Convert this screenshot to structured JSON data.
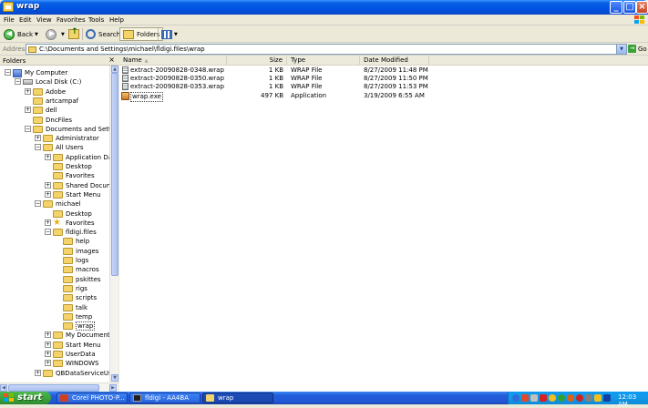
{
  "window": {
    "title": "wrap"
  },
  "menu": [
    "File",
    "Edit",
    "View",
    "Favorites",
    "Tools",
    "Help"
  ],
  "toolbar": {
    "back_label": "Back",
    "search_label": "Search",
    "folders_label": "Folders"
  },
  "address": {
    "label": "Address",
    "value": "C:\\Documents and Settings\\michael\\fldigi.files\\wrap",
    "go_label": "Go"
  },
  "folders_pane": {
    "title": "Folders",
    "close_glyph": "×"
  },
  "tree": [
    {
      "label": "My Computer",
      "level": 0,
      "icon": "computer-icon",
      "expander": "minus"
    },
    {
      "label": "Local Disk (C:)",
      "level": 1,
      "icon": "disk-icon",
      "expander": "minus"
    },
    {
      "label": "Adobe",
      "level": 2,
      "icon": "folder-icon",
      "expander": "plus"
    },
    {
      "label": "artcampaf",
      "level": 2,
      "icon": "folder-icon",
      "expander": ""
    },
    {
      "label": "dell",
      "level": 2,
      "icon": "folder-icon",
      "expander": "plus"
    },
    {
      "label": "DncFiles",
      "level": 2,
      "icon": "folder-icon",
      "expander": ""
    },
    {
      "label": "Documents and Setting",
      "level": 2,
      "icon": "folder-icon",
      "expander": "minus"
    },
    {
      "label": "Administrator",
      "level": 3,
      "icon": "folder-icon",
      "expander": "plus"
    },
    {
      "label": "All Users",
      "level": 3,
      "icon": "folder-icon",
      "expander": "minus"
    },
    {
      "label": "Application Data",
      "level": 4,
      "icon": "folder-icon",
      "expander": "plus"
    },
    {
      "label": "Desktop",
      "level": 4,
      "icon": "folder-icon",
      "expander": ""
    },
    {
      "label": "Favorites",
      "level": 4,
      "icon": "folder-icon",
      "expander": ""
    },
    {
      "label": "Shared Docume",
      "level": 4,
      "icon": "folder-icon",
      "expander": "plus"
    },
    {
      "label": "Start Menu",
      "level": 4,
      "icon": "folder-icon",
      "expander": "plus"
    },
    {
      "label": "michael",
      "level": 3,
      "icon": "folder-icon",
      "expander": "minus"
    },
    {
      "label": "Desktop",
      "level": 4,
      "icon": "folder-icon",
      "expander": ""
    },
    {
      "label": "Favorites",
      "level": 4,
      "icon": "star-icon",
      "expander": "plus"
    },
    {
      "label": "fldigi.files",
      "level": 4,
      "icon": "folder-icon",
      "expander": "minus"
    },
    {
      "label": "help",
      "level": 5,
      "icon": "folder-icon",
      "expander": ""
    },
    {
      "label": "images",
      "level": 5,
      "icon": "folder-icon",
      "expander": ""
    },
    {
      "label": "logs",
      "level": 5,
      "icon": "folder-icon",
      "expander": ""
    },
    {
      "label": "macros",
      "level": 5,
      "icon": "folder-icon",
      "expander": ""
    },
    {
      "label": "pskittes",
      "level": 5,
      "icon": "folder-icon",
      "expander": ""
    },
    {
      "label": "rigs",
      "level": 5,
      "icon": "folder-icon",
      "expander": ""
    },
    {
      "label": "scripts",
      "level": 5,
      "icon": "folder-icon",
      "expander": ""
    },
    {
      "label": "talk",
      "level": 5,
      "icon": "folder-icon",
      "expander": ""
    },
    {
      "label": "temp",
      "level": 5,
      "icon": "folder-icon",
      "expander": ""
    },
    {
      "label": "wrap",
      "level": 5,
      "icon": "folder-icon",
      "expander": "",
      "selected": true
    },
    {
      "label": "My Documents",
      "level": 4,
      "icon": "folder-icon",
      "expander": "plus"
    },
    {
      "label": "Start Menu",
      "level": 4,
      "icon": "folder-icon",
      "expander": "plus"
    },
    {
      "label": "UserData",
      "level": 4,
      "icon": "folder-icon",
      "expander": "plus"
    },
    {
      "label": "WINDOWS",
      "level": 4,
      "icon": "folder-icon",
      "expander": "plus"
    },
    {
      "label": "QBDataServiceUser:",
      "level": 3,
      "icon": "folder-icon",
      "expander": "plus"
    }
  ],
  "columns": {
    "name": "Name",
    "size": "Size",
    "type": "Type",
    "modified": "Date Modified"
  },
  "files": [
    {
      "name": "extract-20090828-0348.wrap",
      "size": "1 KB",
      "type": "WRAP File",
      "modified": "8/27/2009 11:48 PM",
      "icon": "document-icon"
    },
    {
      "name": "extract-20090828-0350.wrap",
      "size": "1 KB",
      "type": "WRAP File",
      "modified": "8/27/2009 11:50 PM",
      "icon": "document-icon"
    },
    {
      "name": "extract-20090828-0353.wrap",
      "size": "1 KB",
      "type": "WRAP File",
      "modified": "8/27/2009 11:53 PM",
      "icon": "document-icon"
    },
    {
      "name": "wrap.exe",
      "size": "497 KB",
      "type": "Application",
      "modified": "3/19/2009 6:55 AM",
      "icon": "application-icon"
    }
  ],
  "taskbar": {
    "start_label": "start",
    "tasks": [
      {
        "label": "Corel PHOTO-P..."
      },
      {
        "label": "fldigi - AA4BA"
      },
      {
        "label": "wrap"
      }
    ],
    "clock": "12:03 AM"
  },
  "colors": {
    "titlebar": "#0054E3",
    "taskbar": "#245EDB",
    "start": "#3A9F3A",
    "tray": "#139AE9",
    "selection": "#316AC5",
    "folder": "#F3D36A"
  }
}
